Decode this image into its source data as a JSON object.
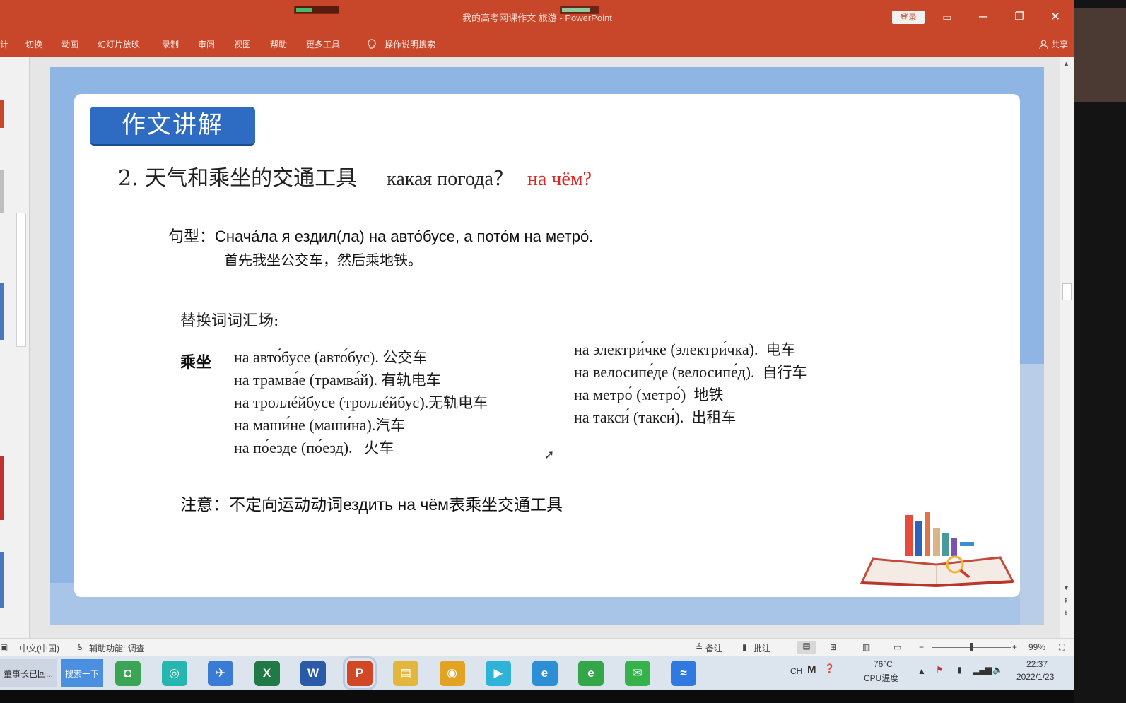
{
  "window": {
    "title": "我的高考网课作文 旅游 - PowerPoint",
    "login_label": "登录",
    "controls": {
      "ribbon_display": "▭",
      "minimize": "─",
      "restore": "❐",
      "close": "✕"
    }
  },
  "ribbon": {
    "tabs": [
      "计",
      "切换",
      "动画",
      "幻灯片放映",
      "录制",
      "审阅",
      "视图",
      "帮助",
      "更多工具"
    ],
    "tell_me": "操作说明搜索",
    "share": "共享"
  },
  "slide": {
    "heading": "作文讲解",
    "title_cn": "2. 天气和乘坐的交通工具",
    "title_ru": "какая погода？",
    "title_red": "на чём?",
    "pattern_label": "句型：",
    "pattern_ru": "Снача́ла я ездил(ла) на авто́бусе, а пото́м на метро́.",
    "pattern_cn": "首先我坐公交车，然后乘地铁。",
    "vocab_title": "替换词词汇场:",
    "ride_label": "乘坐",
    "left_list": [
      {
        "ru": "на авто́бусе (авто́бус).",
        "cn": "公交车"
      },
      {
        "ru": "на трамва́е (трамва́й).",
        "cn": "有轨电车"
      },
      {
        "ru": "на троллéйбусе (троллéйбус).",
        "cn": "无轨电车"
      },
      {
        "ru": "на маши́не (маши́на).",
        "cn": "汽车"
      },
      {
        "ru": "на по́езде (по́езд).",
        "cn": "火车"
      }
    ],
    "right_list": [
      {
        "ru": "на электри́чке (электри́чка).",
        "cn": "电车"
      },
      {
        "ru": "на велосипе́де (велосипе́д).",
        "cn": "自行车"
      },
      {
        "ru": "на метро́ (метро́)",
        "cn": "地铁"
      },
      {
        "ru": "на такси́ (такси́).",
        "cn": "出租车"
      }
    ],
    "note": "注意：不定向运动动词ездить на чём表乘坐交通工具"
  },
  "statusbar": {
    "language": "中文(中国)",
    "accessibility": "辅助功能: 调查",
    "notes": "备注",
    "comments": "批注",
    "zoom_minus": "−",
    "zoom_plus": "+",
    "zoom": "99%",
    "zoom_level": 0.5
  },
  "taskbar": {
    "window_item": "董事长已回...",
    "search_button": "搜索一下",
    "apps": [
      {
        "name": "store",
        "glyph": "◘",
        "color": "#3aa655"
      },
      {
        "name": "browser-360",
        "glyph": "◎",
        "color": "#26b6b0"
      },
      {
        "name": "feishu",
        "glyph": "✈",
        "color": "#3a7bd5"
      },
      {
        "name": "excel",
        "glyph": "X",
        "color": "#1f7a45"
      },
      {
        "name": "word",
        "glyph": "W",
        "color": "#2a5aa8"
      },
      {
        "name": "powerpoint",
        "glyph": "P",
        "color": "#d24726"
      },
      {
        "name": "file-explorer",
        "glyph": "▤",
        "color": "#e3b63e"
      },
      {
        "name": "chrome",
        "glyph": "◉",
        "color": "#e2a323"
      },
      {
        "name": "media-player",
        "glyph": "▶",
        "color": "#2fb3d8"
      },
      {
        "name": "internet-explorer",
        "glyph": "e",
        "color": "#2c8fd6"
      },
      {
        "name": "browser-e",
        "glyph": "e",
        "color": "#33a64a"
      },
      {
        "name": "wechat",
        "glyph": "✉",
        "color": "#35b34a"
      },
      {
        "name": "tencent-meeting",
        "glyph": "≈",
        "color": "#2f79e0"
      }
    ],
    "ime": "CH",
    "temperature": "76°C",
    "cpu_label": "CPU温度",
    "time": "22:37",
    "date": "2022/1/23"
  }
}
